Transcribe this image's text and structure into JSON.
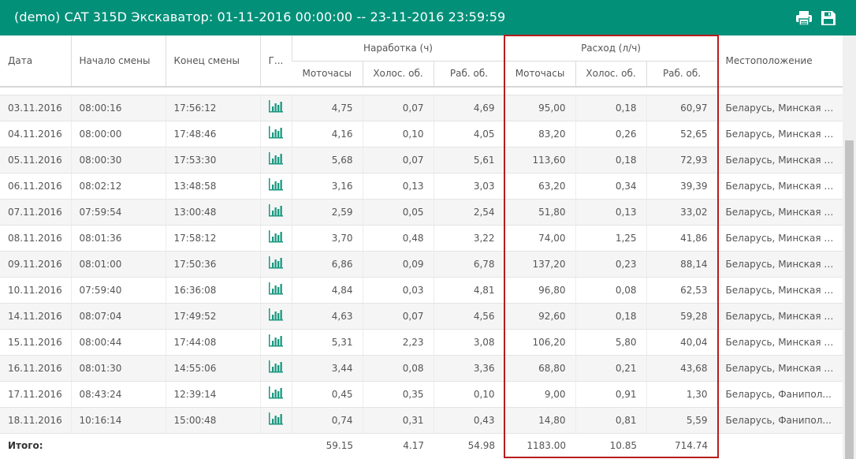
{
  "titlebar": {
    "title": "(demo) CAT 315D Экскаватор: 01-11-2016 00:00:00 -- 23-11-2016 23:59:59"
  },
  "toolbar": {
    "print_icon": "print-icon",
    "save_icon": "save-icon"
  },
  "colors": {
    "header_bg": "#039079",
    "highlight": "#b71c1c",
    "chart_icon": "#1a9880"
  },
  "table": {
    "headers": {
      "date": "Дата",
      "shift_start": "Начало смены",
      "shift_end": "Конец смены",
      "graph": "Г...",
      "operating_hours": "Наработка (ч)",
      "fuel": "Расход (л/ч)",
      "location": "Местоположение",
      "motor": "Моточасы",
      "idle": "Холос. об.",
      "work": "Раб. об.",
      "motor2": "Моточасы",
      "idle2": "Холос. об.",
      "work2": "Раб. об."
    },
    "rows": [
      [
        "03.11.2016",
        "08:00:16",
        "17:56:12",
        "4,75",
        "0,07",
        "4,69",
        "95,00",
        "0,18",
        "60,97",
        "Беларусь, Минская о..."
      ],
      [
        "04.11.2016",
        "08:00:00",
        "17:48:46",
        "4,16",
        "0,10",
        "4,05",
        "83,20",
        "0,26",
        "52,65",
        "Беларусь, Минская о..."
      ],
      [
        "05.11.2016",
        "08:00:30",
        "17:53:30",
        "5,68",
        "0,07",
        "5,61",
        "113,60",
        "0,18",
        "72,93",
        "Беларусь, Минская о..."
      ],
      [
        "06.11.2016",
        "08:02:12",
        "13:48:58",
        "3,16",
        "0,13",
        "3,03",
        "63,20",
        "0,34",
        "39,39",
        "Беларусь, Минская о..."
      ],
      [
        "07.11.2016",
        "07:59:54",
        "13:00:48",
        "2,59",
        "0,05",
        "2,54",
        "51,80",
        "0,13",
        "33,02",
        "Беларусь, Минская о..."
      ],
      [
        "08.11.2016",
        "08:01:36",
        "17:58:12",
        "3,70",
        "0,48",
        "3,22",
        "74,00",
        "1,25",
        "41,86",
        "Беларусь, Минская о..."
      ],
      [
        "09.11.2016",
        "08:01:00",
        "17:50:36",
        "6,86",
        "0,09",
        "6,78",
        "137,20",
        "0,23",
        "88,14",
        "Беларусь, Минская о..."
      ],
      [
        "10.11.2016",
        "07:59:40",
        "16:36:08",
        "4,84",
        "0,03",
        "4,81",
        "96,80",
        "0,08",
        "62,53",
        "Беларусь, Минская о..."
      ],
      [
        "14.11.2016",
        "08:07:04",
        "17:49:52",
        "4,63",
        "0,07",
        "4,56",
        "92,60",
        "0,18",
        "59,28",
        "Беларусь, Минская о..."
      ],
      [
        "15.11.2016",
        "08:00:44",
        "17:44:08",
        "5,31",
        "2,23",
        "3,08",
        "106,20",
        "5,80",
        "40,04",
        "Беларусь, Минская о..."
      ],
      [
        "16.11.2016",
        "08:01:30",
        "14:55:06",
        "3,44",
        "0,08",
        "3,36",
        "68,80",
        "0,21",
        "43,68",
        "Беларусь, Минская о..."
      ],
      [
        "17.11.2016",
        "08:43:24",
        "12:39:14",
        "0,45",
        "0,35",
        "0,10",
        "9,00",
        "0,91",
        "1,30",
        "Беларусь, Фанипол..."
      ],
      [
        "18.11.2016",
        "10:16:14",
        "15:00:48",
        "0,74",
        "0,31",
        "0,43",
        "14,80",
        "0,81",
        "5,59",
        "Беларусь, Фанипол..."
      ]
    ],
    "total": {
      "label": "Итого:",
      "values": [
        "59.15",
        "4.17",
        "54.98",
        "1183.00",
        "10.85",
        "714.74"
      ]
    }
  }
}
